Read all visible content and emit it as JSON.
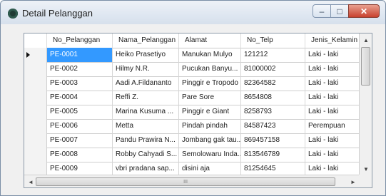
{
  "window": {
    "title": "Detail Pelanggan",
    "controls": {
      "minimize": "–",
      "maximize": "□",
      "close": "✕"
    }
  },
  "grid": {
    "columns": [
      "No_Pelanggan",
      "Nama_Pelanggan",
      "Alamat",
      "No_Telp",
      "Jenis_Kelamin"
    ],
    "rows": [
      [
        "PE-0001",
        "Heiko Prasetiyo",
        "Manukan Mulyo",
        "121212",
        "Laki - laki"
      ],
      [
        "PE-0002",
        "Hilmy N.R.",
        "Pucukan Banyu...",
        "81000002",
        "Laki - laki"
      ],
      [
        "PE-0003",
        "Aadi A.Fildananto",
        "Pinggir e Tropodo",
        "82364582",
        "Laki - laki"
      ],
      [
        "PE-0004",
        "Reffi Z.",
        "Pare Sore",
        "8654808",
        "Laki - laki"
      ],
      [
        "PE-0005",
        "Marina Kusuma ...",
        "Pinggir e Giant",
        "8258793",
        "Laki - laki"
      ],
      [
        "PE-0006",
        "Metta",
        "Pindah pindah",
        "84587423",
        "Perempuan"
      ],
      [
        "PE-0007",
        "Pandu Prawira N...",
        "Jombang gak tau...",
        "869457158",
        "Laki - laki"
      ],
      [
        "PE-0008",
        "Robby Cahyadi S...",
        "Semolowaru Inda...",
        "813546789",
        "Laki - laki"
      ],
      [
        "PE-0009",
        "vbri pradana sap...",
        "disini aja",
        "81254645",
        "Laki - laki"
      ]
    ],
    "selected_row": 0,
    "current_row_marker": "▶"
  },
  "scroll": {
    "up": "▲",
    "down": "▼",
    "left": "◄",
    "right": "►",
    "grip": "III"
  }
}
